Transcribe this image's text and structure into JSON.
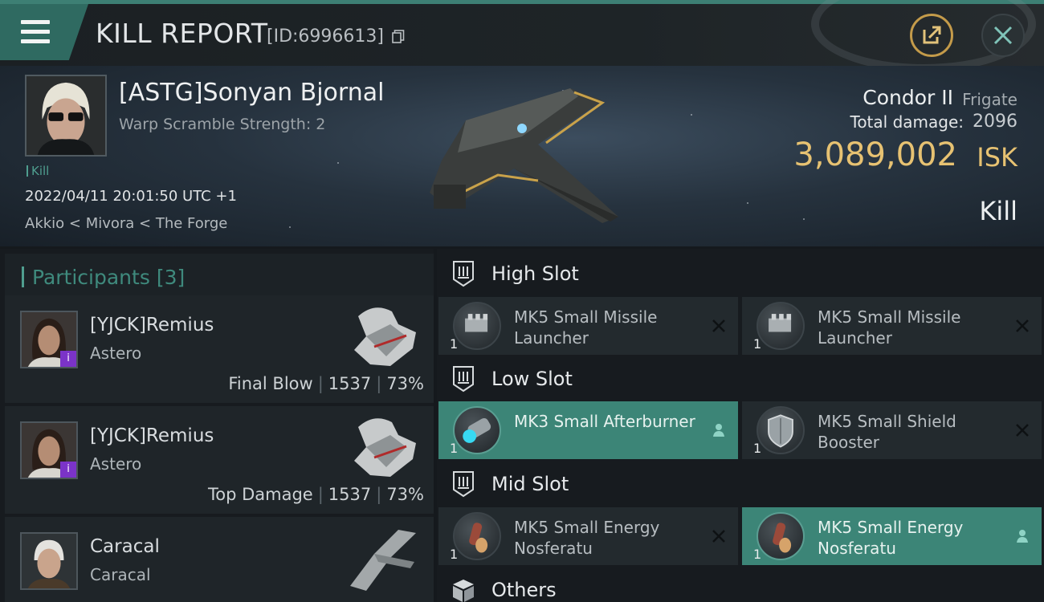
{
  "header": {
    "title": "KILL REPORT",
    "report_id": "[ID:6996613]"
  },
  "victim": {
    "name": "[ASTG]Sonyan Bjornal",
    "subtitle": "Warp Scramble Strength: 2",
    "tag": "Kill",
    "timestamp": "2022/04/11 20:01:50 UTC +1",
    "location": "Akkio < Mivora < The Forge",
    "ship_name": "Condor II",
    "ship_class": "Frigate",
    "damage_label": "Total damage:",
    "damage_value": "2096",
    "isk_value": "3,089,002",
    "isk_unit": "ISK",
    "result": "Kill"
  },
  "participants": {
    "label": "Participants",
    "count": "[3]",
    "rows": [
      {
        "name": "[YJCK]Remius",
        "ship": "Astero",
        "role": "Final Blow",
        "damage": "1537",
        "percent": "73%",
        "badge": "i"
      },
      {
        "name": "[YJCK]Remius",
        "ship": "Astero",
        "role": "Top Damage",
        "damage": "1537",
        "percent": "73%",
        "badge": "i"
      },
      {
        "name": "Caracal",
        "ship": "Caracal",
        "role": "",
        "damage": "",
        "percent": "",
        "badge": ""
      }
    ]
  },
  "fitting": {
    "high_slot": {
      "label": "High Slot",
      "modules": [
        {
          "name": "MK5 Small Missile Launcher",
          "qty": "1",
          "status": "destroyed"
        },
        {
          "name": "MK5 Small Missile Launcher",
          "qty": "1",
          "status": "destroyed"
        }
      ]
    },
    "low_slot": {
      "label": "Low Slot",
      "modules": [
        {
          "name": "MK3 Small Afterburner",
          "qty": "1",
          "status": "dropped"
        },
        {
          "name": "MK5 Small Shield Booster",
          "qty": "1",
          "status": "destroyed"
        }
      ]
    },
    "mid_slot": {
      "label": "Mid Slot",
      "modules": [
        {
          "name": "MK5 Small Energy Nosferatu",
          "qty": "1",
          "status": "destroyed"
        },
        {
          "name": "MK5 Small Energy Nosferatu",
          "qty": "1",
          "status": "dropped"
        }
      ]
    },
    "others": {
      "label": "Others"
    }
  },
  "colors": {
    "accent_teal": "#3c8577",
    "isk_gold": "#e7c272",
    "badge_purple": "#7b33c8"
  }
}
